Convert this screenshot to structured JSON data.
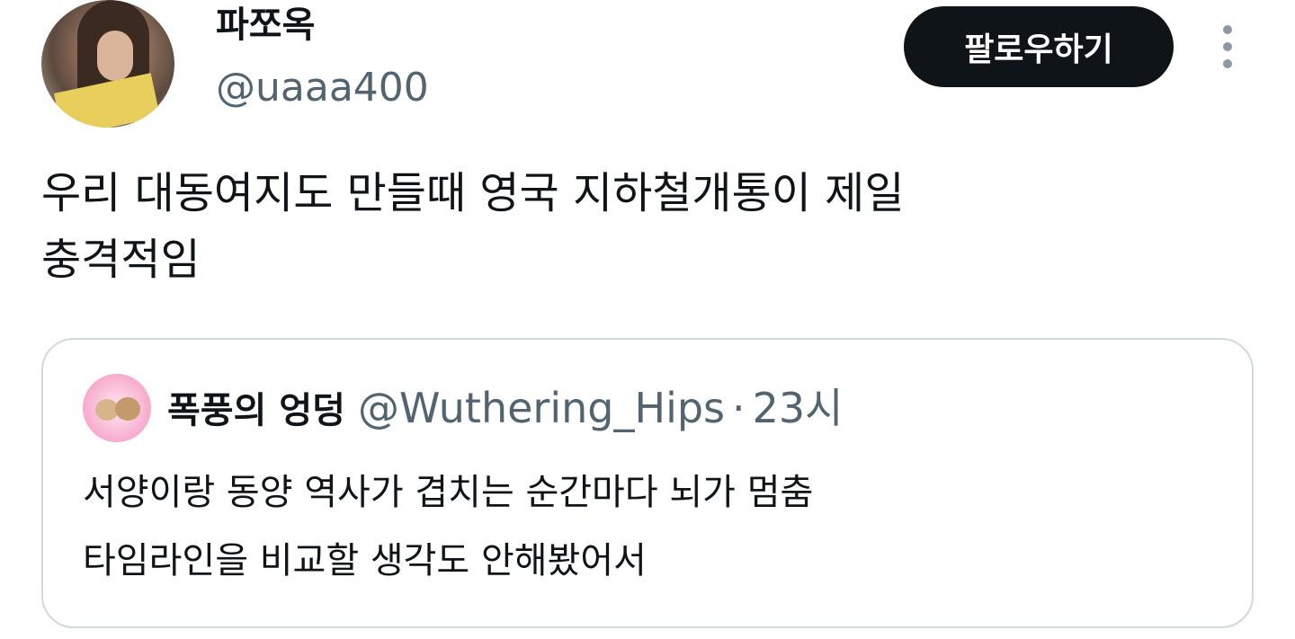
{
  "author": {
    "display_name": "파쪼옥",
    "handle": "@uaaa400"
  },
  "actions": {
    "follow_label": "팔로우하기",
    "more_icon": "more-vertical-icon"
  },
  "tweet": {
    "text": "우리 대동여지도 만들때 영국 지하철개통이 제일\n충격적임"
  },
  "quote": {
    "display_name": "폭풍의 엉덩",
    "handle": "@Wuthering_Hips",
    "separator": "·",
    "time": "23시",
    "text": "서양이랑 동양 역사가 겹치는 순간마다 뇌가 멈춤\n타임라인을 비교할 생각도 안해봤어서"
  },
  "colors": {
    "text_primary": "#0f1419",
    "text_secondary": "#536471",
    "button_bg": "#0f1419",
    "border": "#cfd9de"
  }
}
